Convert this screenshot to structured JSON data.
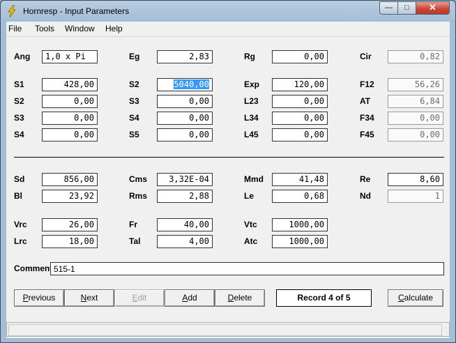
{
  "window": {
    "title": "Hornresp - Input Parameters"
  },
  "menu": [
    "File",
    "Tools",
    "Window",
    "Help"
  ],
  "params": {
    "Ang": {
      "label": "Ang",
      "value": "1,0 x Pi"
    },
    "Eg": {
      "label": "Eg",
      "value": "2,83"
    },
    "Rg": {
      "label": "Rg",
      "value": "0,00"
    },
    "Cir": {
      "label": "Cir",
      "value": "0,82"
    },
    "S1": {
      "label": "S1",
      "value": "428,00"
    },
    "S2a": {
      "label": "S2",
      "value": "5040,00"
    },
    "Exp": {
      "label": "Exp",
      "value": "120,00"
    },
    "F12": {
      "label": "F12",
      "value": "56,26"
    },
    "S2b": {
      "label": "S2",
      "value": "0,00"
    },
    "S3a": {
      "label": "S3",
      "value": "0,00"
    },
    "L23": {
      "label": "L23",
      "value": "0,00"
    },
    "AT": {
      "label": "AT",
      "value": "6,84"
    },
    "S3b": {
      "label": "S3",
      "value": "0,00"
    },
    "S4a": {
      "label": "S4",
      "value": "0,00"
    },
    "L34": {
      "label": "L34",
      "value": "0,00"
    },
    "F34": {
      "label": "F34",
      "value": "0,00"
    },
    "S4b": {
      "label": "S4",
      "value": "0,00"
    },
    "S5": {
      "label": "S5",
      "value": "0,00"
    },
    "L45": {
      "label": "L45",
      "value": "0,00"
    },
    "F45": {
      "label": "F45",
      "value": "0,00"
    },
    "Sd": {
      "label": "Sd",
      "value": "856,00"
    },
    "Cms": {
      "label": "Cms",
      "value": "3,32E-04"
    },
    "Mmd": {
      "label": "Mmd",
      "value": "41,48"
    },
    "Re": {
      "label": "Re",
      "value": "8,60"
    },
    "Bl": {
      "label": "Bl",
      "value": "23,92"
    },
    "Rms": {
      "label": "Rms",
      "value": "2,88"
    },
    "Le": {
      "label": "Le",
      "value": "0,68"
    },
    "Nd": {
      "label": "Nd",
      "value": "1"
    },
    "Vrc": {
      "label": "Vrc",
      "value": "26,00"
    },
    "Fr": {
      "label": "Fr",
      "value": "40,00"
    },
    "Vtc": {
      "label": "Vtc",
      "value": "1000,00"
    },
    "Lrc": {
      "label": "Lrc",
      "value": "18,00"
    },
    "Tal": {
      "label": "Tal",
      "value": "4,00"
    },
    "Atc": {
      "label": "Atc",
      "value": "1000,00"
    }
  },
  "comment": {
    "label": "Comment",
    "value": "515-1"
  },
  "buttons": {
    "previous": {
      "pre": "",
      "u": "P",
      "post": "revious"
    },
    "next": {
      "pre": "",
      "u": "N",
      "post": "ext"
    },
    "edit": {
      "pre": "",
      "u": "E",
      "post": "dit"
    },
    "add": {
      "pre": "",
      "u": "A",
      "post": "dd"
    },
    "delete": {
      "pre": "",
      "u": "D",
      "post": "elete"
    },
    "calculate": {
      "pre": "",
      "u": "C",
      "post": "alculate"
    }
  },
  "record": "Record 4 of 5",
  "colors": {
    "selection": "#3399ff",
    "close_button": "#c7442f"
  },
  "icons": {
    "app": "lightning-bolt-icon"
  }
}
